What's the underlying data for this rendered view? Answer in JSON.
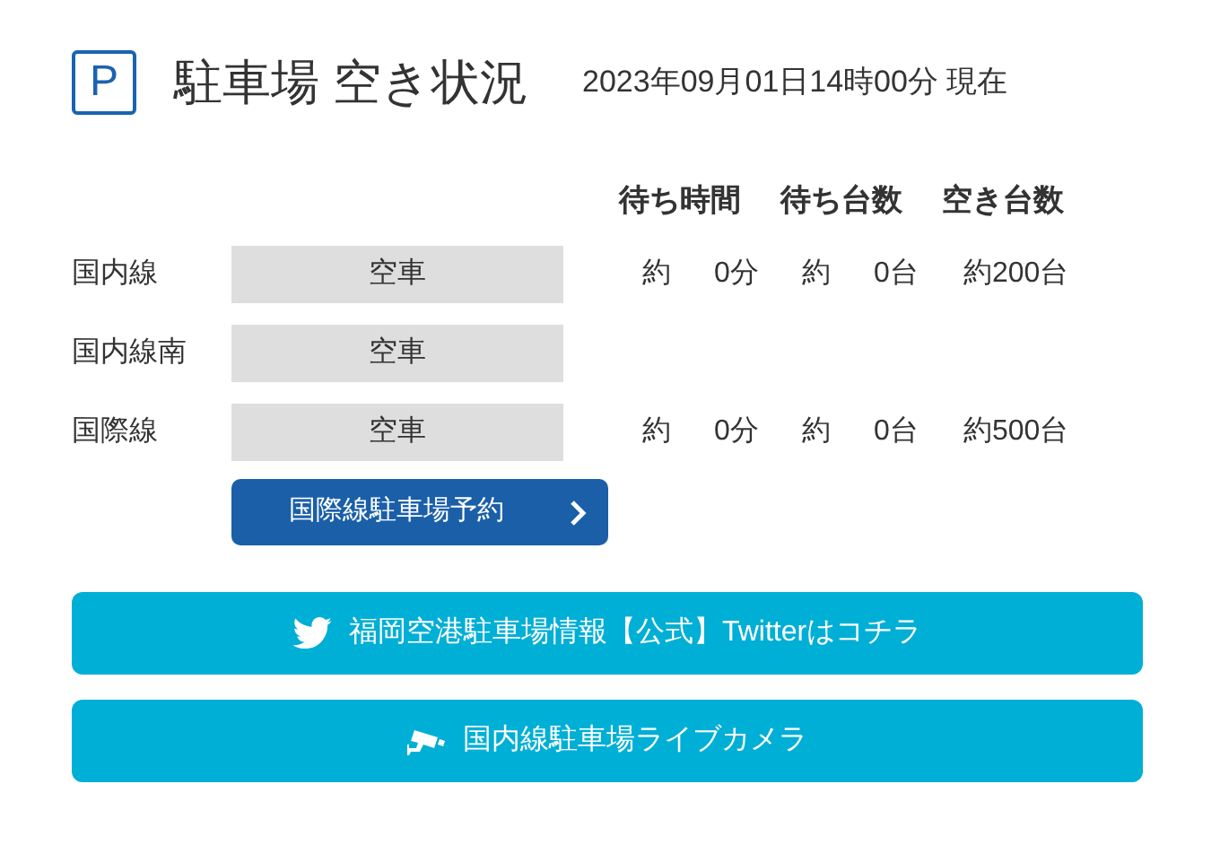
{
  "header": {
    "icon_letter": "P",
    "title": "駐車場 空き状況",
    "timestamp": "2023年09月01日14時00分 現在"
  },
  "columns": [
    "待ち時間",
    "待ち台数",
    "空き台数"
  ],
  "rows": [
    {
      "name": "国内線",
      "status": "空車",
      "wait_time": {
        "approx": "約",
        "amount": "0分"
      },
      "waiting_cars": {
        "approx": "約",
        "amount": "0台"
      },
      "free_spaces": "約200台"
    },
    {
      "name": "国内線南",
      "status": "空車"
    },
    {
      "name": "国際線",
      "status": "空車",
      "wait_time": {
        "approx": "約",
        "amount": "0分"
      },
      "waiting_cars": {
        "approx": "約",
        "amount": "0台"
      },
      "free_spaces": "約500台"
    }
  ],
  "reserve_button": "国際線駐車場予約",
  "links": [
    {
      "kind": "twitter",
      "label": "福岡空港駐車場情報【公式】Twitterはコチラ"
    },
    {
      "kind": "camera",
      "label": "国内線駐車場ライブカメラ"
    }
  ]
}
